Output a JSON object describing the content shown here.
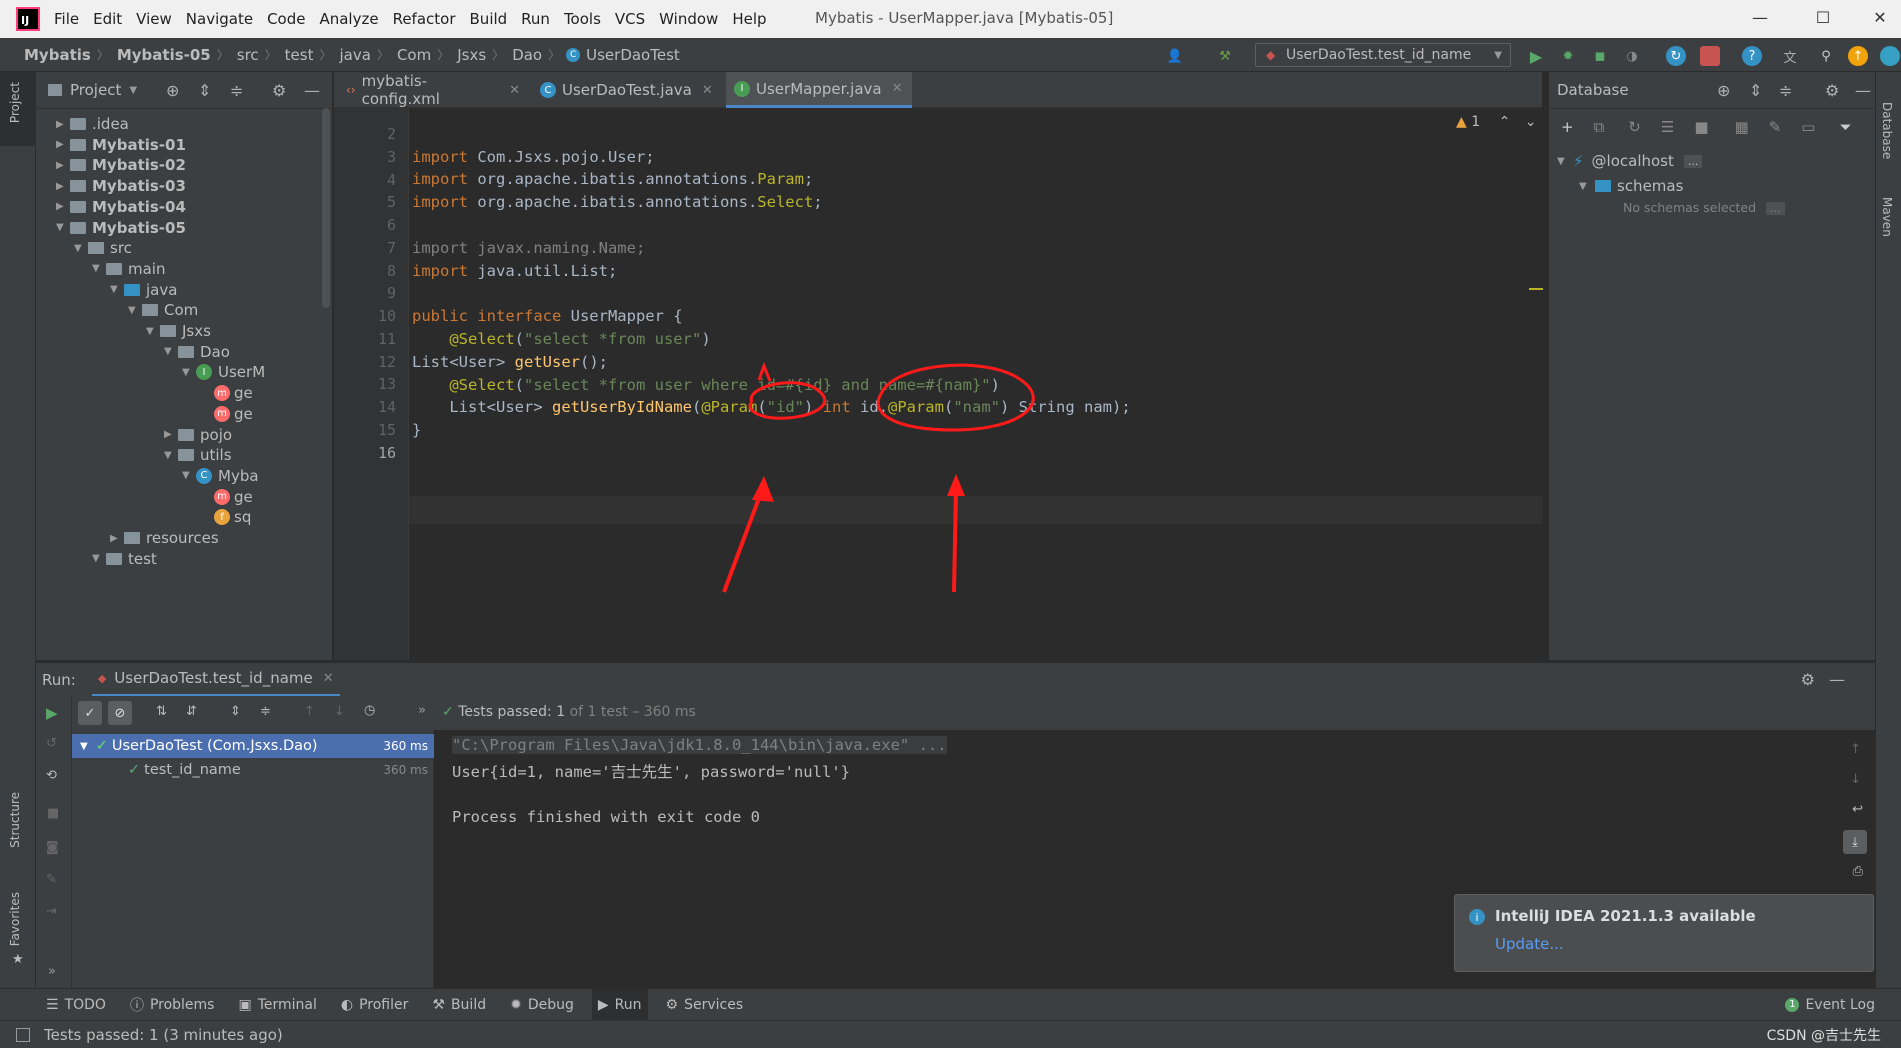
{
  "menu": {
    "items": [
      "File",
      "Edit",
      "View",
      "Navigate",
      "Code",
      "Analyze",
      "Refactor",
      "Build",
      "Run",
      "Tools",
      "VCS",
      "Window",
      "Help"
    ],
    "window_title": "Mybatis - UserMapper.java [Mybatis-05]",
    "logo_text": "IJ"
  },
  "breadcrumb": [
    "Mybatis",
    "Mybatis-05",
    "src",
    "test",
    "java",
    "Com",
    "Jsxs",
    "Dao",
    "UserDaoTest"
  ],
  "toolbar": {
    "run_config": "UserDaoTest.test_id_name"
  },
  "left_strip": {
    "project": "Project",
    "structure": "Structure",
    "favorites": "Favorites"
  },
  "right_strip": {
    "database": "Database",
    "maven": "Maven"
  },
  "project": {
    "title": "Project",
    "tree": [
      {
        "label": ".idea",
        "depth": 0,
        "arrow": "▶",
        "kind": "folder",
        "bold": false
      },
      {
        "label": "Mybatis-01",
        "depth": 0,
        "arrow": "▶",
        "kind": "folder",
        "bold": true
      },
      {
        "label": "Mybatis-02",
        "depth": 0,
        "arrow": "▶",
        "kind": "folder",
        "bold": true
      },
      {
        "label": "Mybatis-03",
        "depth": 0,
        "arrow": "▶",
        "kind": "folder",
        "bold": true
      },
      {
        "label": "Mybatis-04",
        "depth": 0,
        "arrow": "▶",
        "kind": "folder",
        "bold": true
      },
      {
        "label": "Mybatis-05",
        "depth": 0,
        "arrow": "▼",
        "kind": "folder",
        "bold": true
      },
      {
        "label": "src",
        "depth": 1,
        "arrow": "▼",
        "kind": "folder",
        "bold": false
      },
      {
        "label": "main",
        "depth": 2,
        "arrow": "▼",
        "kind": "folder",
        "bold": false
      },
      {
        "label": "java",
        "depth": 3,
        "arrow": "▼",
        "kind": "folder-blue",
        "bold": false
      },
      {
        "label": "Com",
        "depth": 4,
        "arrow": "▼",
        "kind": "folder",
        "bold": false
      },
      {
        "label": "Jsxs",
        "depth": 5,
        "arrow": "▼",
        "kind": "folder",
        "bold": false
      },
      {
        "label": "Dao",
        "depth": 6,
        "arrow": "▼",
        "kind": "folder",
        "bold": false
      },
      {
        "label": "UserM",
        "depth": 7,
        "arrow": "▼",
        "kind": "interface",
        "bold": false
      },
      {
        "label": "ge",
        "depth": 8,
        "arrow": "",
        "kind": "method",
        "bold": false
      },
      {
        "label": "ge",
        "depth": 8,
        "arrow": "",
        "kind": "method",
        "bold": false
      },
      {
        "label": "pojo",
        "depth": 6,
        "arrow": "▶",
        "kind": "folder",
        "bold": false
      },
      {
        "label": "utils",
        "depth": 6,
        "arrow": "▼",
        "kind": "folder",
        "bold": false
      },
      {
        "label": "Myba",
        "depth": 7,
        "arrow": "▼",
        "kind": "class",
        "bold": false
      },
      {
        "label": "ge",
        "depth": 8,
        "arrow": "",
        "kind": "method",
        "bold": false
      },
      {
        "label": "sq",
        "depth": 8,
        "arrow": "",
        "kind": "field",
        "bold": false
      },
      {
        "label": "resources",
        "depth": 3,
        "arrow": "▶",
        "kind": "folder",
        "bold": false
      },
      {
        "label": "test",
        "depth": 2,
        "arrow": "▼",
        "kind": "folder",
        "bold": false
      }
    ]
  },
  "editor": {
    "tabs": [
      {
        "label": "mybatis-config.xml",
        "active": false
      },
      {
        "label": "UserDaoTest.java",
        "active": false
      },
      {
        "label": "UserMapper.java",
        "active": true
      }
    ],
    "warnings": "1",
    "line_numbers": [
      "2",
      "3",
      "4",
      "5",
      "6",
      "7",
      "8",
      "9",
      "10",
      "11",
      "12",
      "13",
      "14",
      "15",
      "16"
    ]
  },
  "database": {
    "title": "Database",
    "host": "@localhost",
    "host_more": "...",
    "schemas": "schemas",
    "no_schemas": "No schemas selected",
    "no_schemas_more": "..."
  },
  "run": {
    "label": "Run:",
    "tab": "UserDaoTest.test_id_name",
    "status_prefix": "Tests passed:",
    "status_count": "1",
    "status_suffix": "of 1 test – 360 ms",
    "tree": [
      {
        "label": "UserDaoTest (Com.Jsxs.Dao)",
        "time": "360 ms",
        "selected": true
      },
      {
        "label": "test_id_name",
        "time": "360 ms",
        "selected": false
      }
    ],
    "console": [
      "\"C:\\Program Files\\Java\\jdk1.8.0_144\\bin\\java.exe\" ...",
      "User{id=1, name='吉士先生', password='null'}",
      "",
      "Process finished with exit code 0"
    ]
  },
  "bottom_tabs": [
    "TODO",
    "Problems",
    "Terminal",
    "Profiler",
    "Build",
    "Debug",
    "Run",
    "Services"
  ],
  "event_log": "Event Log",
  "status": {
    "text": "Tests passed: 1 (3 minutes ago)",
    "watermark": "CSDN @吉士先生"
  },
  "notification": {
    "title": "IntelliJ IDEA 2021.1.3 available",
    "link": "Update..."
  },
  "colors": {
    "background": "#2b2b2b",
    "panel": "#3c3f41",
    "accent": "#4a88c7",
    "keyword": "#cc7832",
    "annotation": "#bbb529",
    "string": "#6a8759",
    "pass": "#499c54",
    "annotation_ink": "#ff1a1a"
  }
}
